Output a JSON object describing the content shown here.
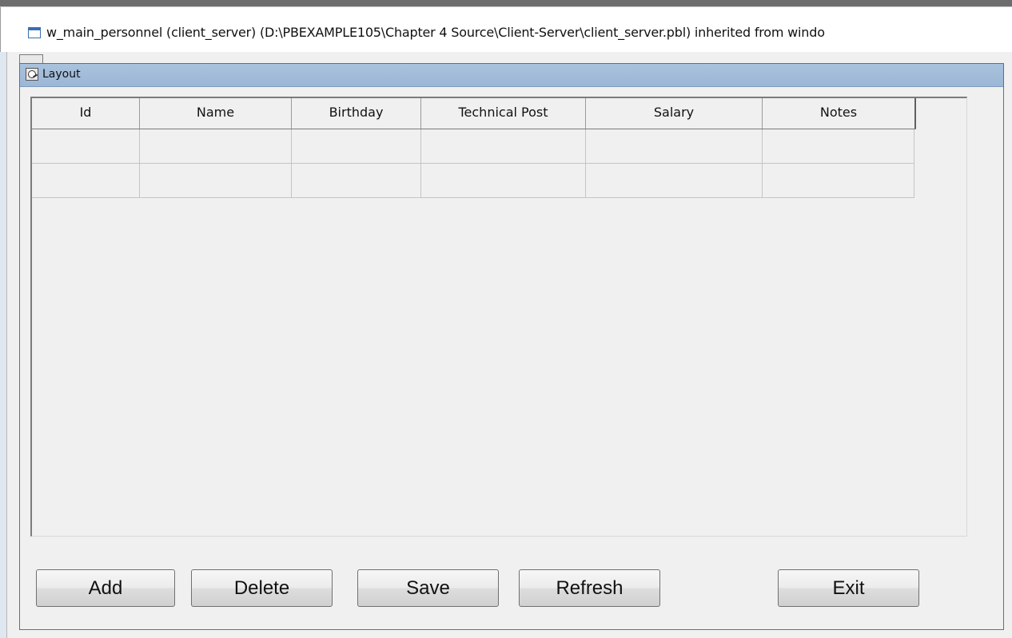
{
  "window": {
    "title": "w_main_personnel (client_server) (D:\\PBEXAMPLE105\\Chapter 4 Source\\Client-Server\\client_server.pbl) inherited from windo"
  },
  "panel": {
    "title": "Layout"
  },
  "grid": {
    "columns": [
      "Id",
      "Name",
      "Birthday",
      "Technical Post",
      "Salary",
      "Notes"
    ],
    "rows": [
      [
        "",
        "",
        "",
        "",
        "",
        ""
      ],
      [
        "",
        "",
        "",
        "",
        "",
        ""
      ]
    ]
  },
  "buttons": {
    "add": "Add",
    "delete": "Delete",
    "save": "Save",
    "refresh": "Refresh",
    "exit": "Exit"
  },
  "icons": {
    "window": "window-icon",
    "layout": "layout-icon"
  }
}
